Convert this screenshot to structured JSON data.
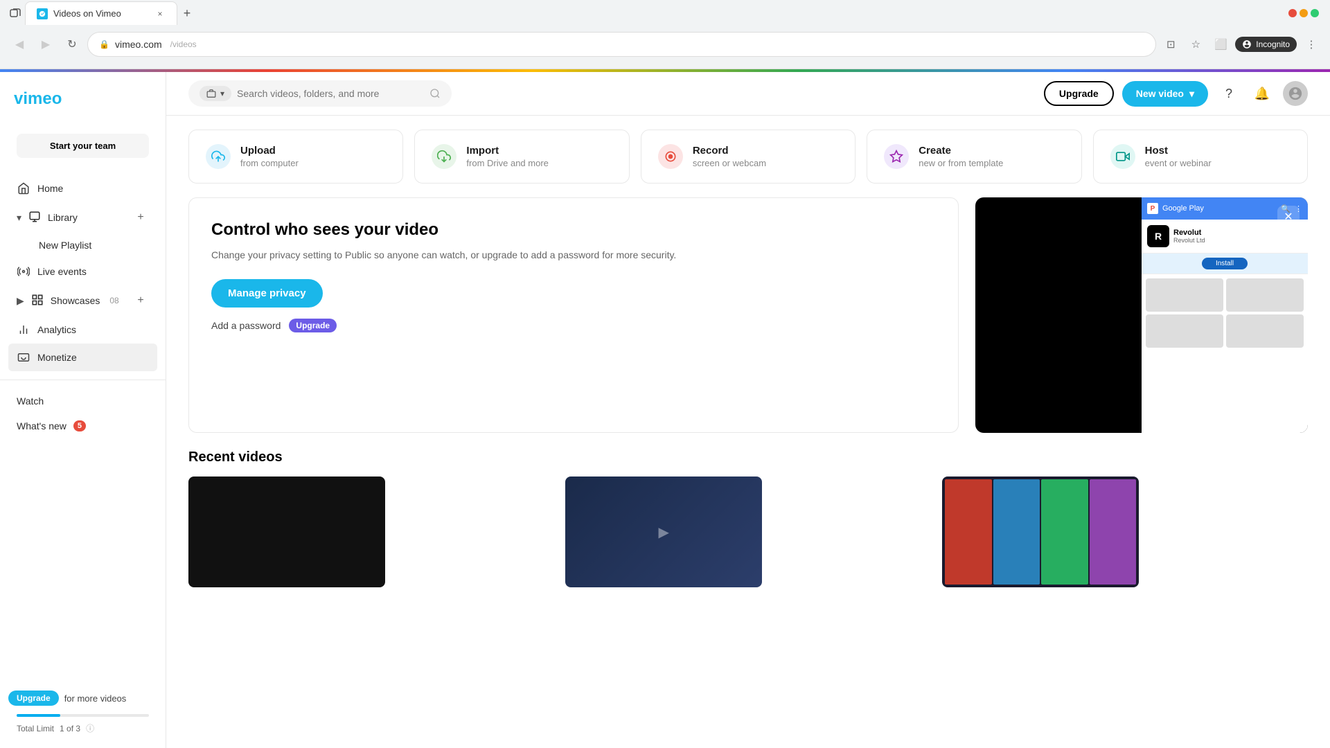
{
  "browser": {
    "back_btn": "◀",
    "forward_btn": "▶",
    "reload_btn": "↻",
    "url": "vimeo.com",
    "tab_title": "Videos on Vimeo",
    "new_tab_icon": "+",
    "incognito_label": "Incognito",
    "favicon_letter": "V"
  },
  "header": {
    "search_placeholder": "Search videos, folders, and more",
    "upgrade_label": "Upgrade",
    "new_video_label": "New video",
    "chevron_down": "▾"
  },
  "sidebar": {
    "start_team_label": "Start your team",
    "home_label": "Home",
    "library_label": "Library",
    "new_playlist_label": "New Playlist",
    "live_events_label": "Live events",
    "showcases_label": "Showcases",
    "showcases_count": "08",
    "analytics_label": "Analytics",
    "monetize_label": "Monetize",
    "watch_label": "Watch",
    "whats_new_label": "What's new",
    "whats_new_badge": "5",
    "upgrade_label": "Upgrade",
    "upgrade_for_more": "for more videos",
    "total_limit_label": "Total Limit",
    "total_limit_value": "1 of 3",
    "progress_percent": 33
  },
  "upload_cards": [
    {
      "id": "upload",
      "icon_name": "upload-icon",
      "icon_char": "↑",
      "icon_color": "blue",
      "title": "Upload",
      "sub": "from computer"
    },
    {
      "id": "import",
      "icon_name": "import-icon",
      "icon_char": "⬇",
      "icon_color": "green",
      "title": "Import",
      "sub": "from Drive and more"
    },
    {
      "id": "record",
      "icon_name": "record-icon",
      "icon_char": "⏺",
      "icon_color": "red",
      "title": "Record",
      "sub": "screen or webcam"
    },
    {
      "id": "create",
      "icon_name": "create-icon",
      "icon_char": "✦",
      "icon_color": "purple",
      "title": "Create",
      "sub": "new or from template"
    },
    {
      "id": "host",
      "icon_name": "host-icon",
      "icon_char": "▶",
      "icon_color": "teal",
      "title": "Host",
      "sub": "event or webinar"
    }
  ],
  "privacy_panel": {
    "title": "Control who sees your video",
    "description": "Change your privacy setting to Public so anyone can watch,\nor upgrade to add a password for more security.",
    "manage_btn": "Manage privacy",
    "add_password_label": "Add a password",
    "upgrade_tag": "Upgrade"
  },
  "recent_section": {
    "title": "Recent videos"
  },
  "video_thumb_colors": [
    "#0d1b2a",
    "#1e2d4a",
    "#1a1a2e"
  ]
}
